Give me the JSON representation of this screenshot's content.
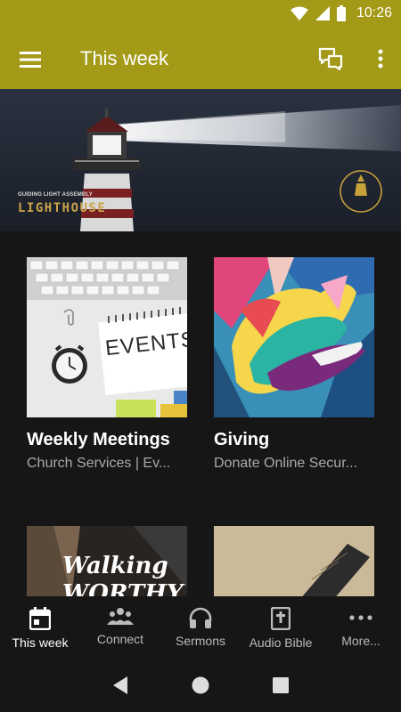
{
  "status_bar": {
    "time": "10:26"
  },
  "app_bar": {
    "title": "This week"
  },
  "banner": {
    "caption": "GUIDING LIGHT ASSEMBLY",
    "word": "LIGHTHOUSE"
  },
  "cards": [
    {
      "title": "Weekly Meetings",
      "subtitle": "Church Services | Ev...",
      "image_text": "EVENTS"
    },
    {
      "title": "Giving",
      "subtitle": "Donate Online Secur..."
    },
    {
      "image_text": "Walking WORTHY"
    },
    {}
  ],
  "bottom_nav": [
    {
      "label": "This week",
      "icon": "calendar-icon"
    },
    {
      "label": "Connect",
      "icon": "people-icon"
    },
    {
      "label": "Sermons",
      "icon": "headphones-icon"
    },
    {
      "label": "Audio Bible",
      "icon": "bible-icon"
    },
    {
      "label": "More...",
      "icon": "more-horizontal-icon"
    }
  ],
  "colors": {
    "app_bar": "#A39A17",
    "background": "#161616"
  }
}
